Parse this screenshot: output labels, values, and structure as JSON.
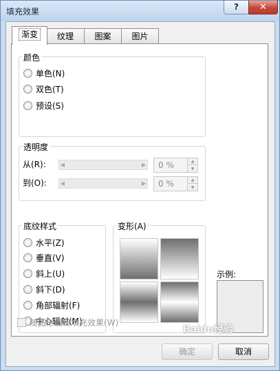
{
  "window": {
    "title": "填充效果",
    "help_label": "?",
    "close_label": "✕"
  },
  "tabs": [
    {
      "label": "渐变",
      "active": true
    },
    {
      "label": "纹理",
      "active": false
    },
    {
      "label": "图案",
      "active": false
    },
    {
      "label": "图片",
      "active": false
    }
  ],
  "colors_group": {
    "label": "颜色",
    "options": [
      "单色(N)",
      "双色(T)",
      "预设(S)"
    ]
  },
  "transparency_group": {
    "label": "透明度",
    "from_label": "从(R):",
    "to_label": "到(O):",
    "from_value": "0 %",
    "to_value": "0 %"
  },
  "shading_group": {
    "label": "底纹样式",
    "options": [
      "水平(Z)",
      "垂直(V)",
      "斜上(U)",
      "斜下(D)",
      "角部辐射(F)",
      "中心辐射(M)"
    ]
  },
  "variants_group": {
    "label": "变形(A)"
  },
  "sample_label": "示例:",
  "rotate_checkbox_label": "随图形旋转填充效果(W)",
  "buttons": {
    "ok": "确定",
    "cancel": "取消"
  },
  "watermark_text": "Baidu经验"
}
